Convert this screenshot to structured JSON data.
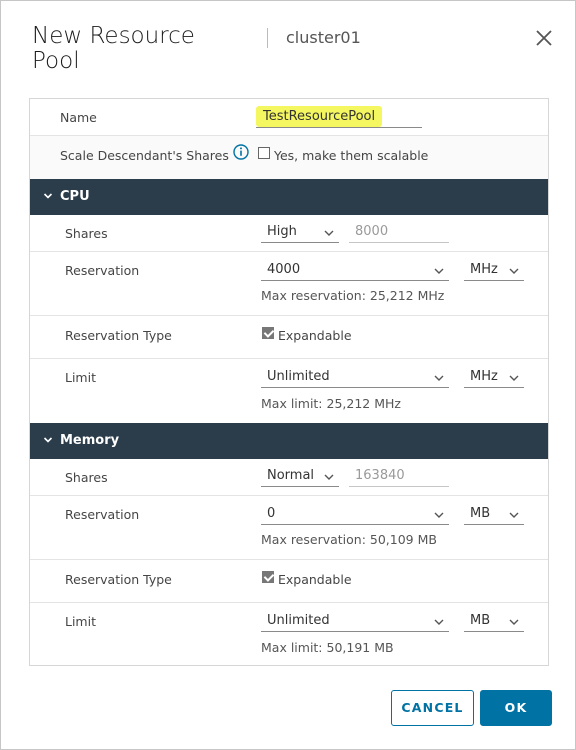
{
  "dialog": {
    "title": "New Resource Pool",
    "subtitle": "cluster01",
    "close_icon": "close-icon"
  },
  "general": {
    "name_label": "Name",
    "name_value": "TestResourcePool",
    "scale_label": "Scale Descendant's Shares",
    "scale_checkbox_label": "Yes, make them scalable",
    "scale_checked": false
  },
  "cpu": {
    "header": "CPU",
    "shares_label": "Shares",
    "shares_level": "High",
    "shares_value": "8000",
    "reservation_label": "Reservation",
    "reservation_value": "4000",
    "reservation_unit": "MHz",
    "reservation_hint": "Max reservation: 25,212 MHz",
    "reservation_type_label": "Reservation Type",
    "expandable_label": "Expandable",
    "expandable_checked": true,
    "limit_label": "Limit",
    "limit_value": "Unlimited",
    "limit_unit": "MHz",
    "limit_hint": "Max limit: 25,212 MHz"
  },
  "memory": {
    "header": "Memory",
    "shares_label": "Shares",
    "shares_level": "Normal",
    "shares_value": "163840",
    "reservation_label": "Reservation",
    "reservation_value": "0",
    "reservation_unit": "MB",
    "reservation_hint": "Max reservation: 50,109 MB",
    "reservation_type_label": "Reservation Type",
    "expandable_label": "Expandable",
    "expandable_checked": true,
    "limit_label": "Limit",
    "limit_value": "Unlimited",
    "limit_unit": "MB",
    "limit_hint": "Max limit: 50,191 MB"
  },
  "footer": {
    "cancel_label": "CANCEL",
    "ok_label": "OK"
  },
  "colors": {
    "accent": "#0072a3",
    "header_bg": "#2b3c4a",
    "highlight": "#f4f75f"
  }
}
